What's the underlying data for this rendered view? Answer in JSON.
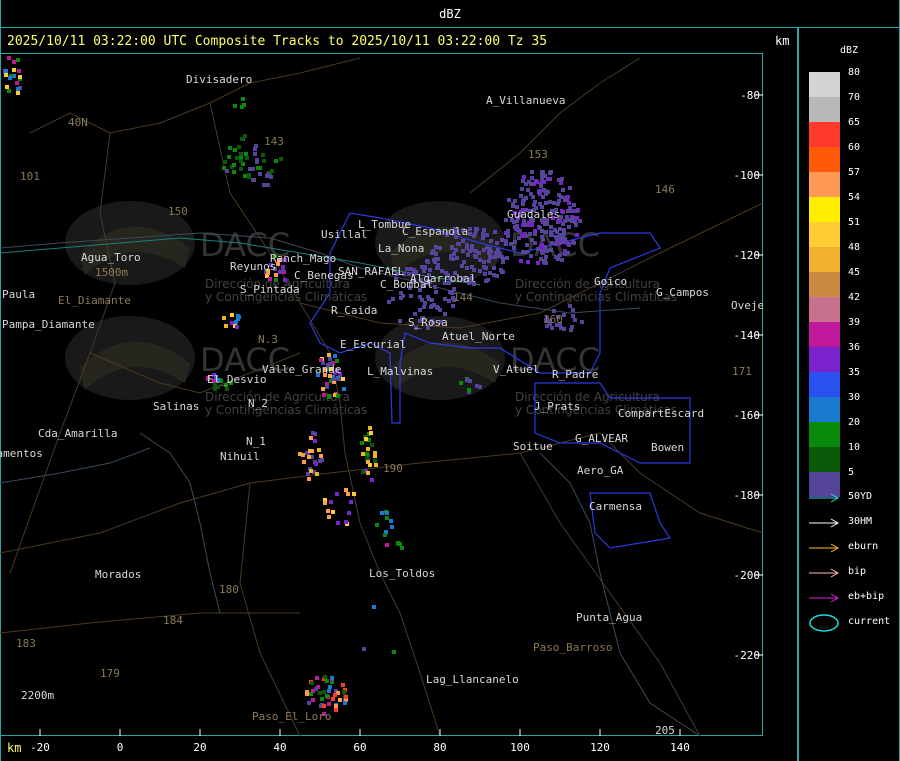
{
  "title": "dBZ",
  "header": "2025/10/11 03:22:00 UTC Composite Tracks to 2025/10/11 03:22:00 Tz 35",
  "km_top": "km",
  "km_bottom": "km",
  "x_ticks": [
    "-20",
    "0",
    "20",
    "40",
    "60",
    "80",
    "100",
    "120",
    "140"
  ],
  "y_ticks": [
    "-80",
    "-100",
    "-120",
    "-140",
    "-160",
    "-180",
    "-200",
    "-220"
  ],
  "legend": {
    "title": "dBZ",
    "levels": [
      {
        "label": "80",
        "color": "#d4d4d4"
      },
      {
        "label": "70",
        "color": "#b8b8b8"
      },
      {
        "label": "65",
        "color": "#ff3a2a"
      },
      {
        "label": "60",
        "color": "#ff5a0a"
      },
      {
        "label": "57",
        "color": "#ff9955"
      },
      {
        "label": "54",
        "color": "#ffee00"
      },
      {
        "label": "51",
        "color": "#ffcc33"
      },
      {
        "label": "48",
        "color": "#f0b030"
      },
      {
        "label": "45",
        "color": "#cc8a40"
      },
      {
        "label": "42",
        "color": "#c87090"
      },
      {
        "label": "39",
        "color": "#c0189a"
      },
      {
        "label": "36",
        "color": "#7a22cc"
      },
      {
        "label": "35",
        "color": "#2a50ee"
      },
      {
        "label": "30",
        "color": "#1a7ad0"
      },
      {
        "label": "20",
        "color": "#0a8a0a"
      },
      {
        "label": "10",
        "color": "#0a5a0a"
      },
      {
        "label": "5",
        "color": "#554499"
      }
    ],
    "tracks": [
      {
        "label": "50YD",
        "color": "#22dddd"
      },
      {
        "label": "30HM",
        "color": "#ffffff"
      },
      {
        "label": "eburn",
        "color": "#ffbb33"
      },
      {
        "label": "bip",
        "color": "#ffbbbb"
      },
      {
        "label": "eb+bip",
        "color": "#dd22dd"
      }
    ],
    "current_label": "current",
    "current_color": "#22dddd"
  },
  "places": [
    {
      "name": "Divisadero"
    },
    {
      "name": "A_Villanueva"
    },
    {
      "name": "40N"
    },
    {
      "name": "101"
    },
    {
      "name": "150"
    },
    {
      "name": "153"
    },
    {
      "name": "146"
    },
    {
      "name": "143"
    },
    {
      "name": "Usillal"
    },
    {
      "name": "L_Tombue"
    },
    {
      "name": "C_Espanola"
    },
    {
      "name": "La_Nona"
    },
    {
      "name": "Guadales"
    },
    {
      "name": "Agua_Toro"
    },
    {
      "name": "1500m"
    },
    {
      "name": "Reyunos"
    },
    {
      "name": "Ranch_Mago"
    },
    {
      "name": "C_Benegas"
    },
    {
      "name": "SAN_RAFAEL"
    },
    {
      "name": "Algarrobal"
    },
    {
      "name": "C_Bombal"
    },
    {
      "name": "Goico"
    },
    {
      "name": "G_Campos"
    },
    {
      "name": "Ovejer"
    },
    {
      "name": "Paula"
    },
    {
      "name": "Pampa_Diamante"
    },
    {
      "name": "S_Pintada"
    },
    {
      "name": "El_Diamante"
    },
    {
      "name": "R_Caida"
    },
    {
      "name": "S_Rosa"
    },
    {
      "name": "Atuel_Norte"
    },
    {
      "name": "E_Escurial"
    },
    {
      "name": "Valle_Grande"
    },
    {
      "name": "L_Malvinas"
    },
    {
      "name": "V_Atuel"
    },
    {
      "name": "R_Padre"
    },
    {
      "name": "El_Desvio"
    },
    {
      "name": "Salinas"
    },
    {
      "name": "N_2"
    },
    {
      "name": "N_1"
    },
    {
      "name": "Nihuil"
    },
    {
      "name": "Cda_Amarilla"
    },
    {
      "name": "Carramentos"
    },
    {
      "name": "J_Prats"
    },
    {
      "name": "CompartEscard"
    },
    {
      "name": "G_ALVEAR"
    },
    {
      "name": "Soitue"
    },
    {
      "name": "Bowen"
    },
    {
      "name": "Aero_GA"
    },
    {
      "name": "Carmensa"
    },
    {
      "name": "Los_Toldos"
    },
    {
      "name": "Morados"
    },
    {
      "name": "180"
    },
    {
      "name": "184"
    },
    {
      "name": "183"
    },
    {
      "name": "179"
    },
    {
      "name": "190"
    },
    {
      "name": "Paso_Barroso"
    },
    {
      "name": "Punta_Agua"
    },
    {
      "name": "Lag_Llancanelo"
    },
    {
      "name": "2200m"
    },
    {
      "name": "Paso_El_Loro"
    },
    {
      "name": "205"
    },
    {
      "name": "171"
    },
    {
      "name": "160"
    },
    {
      "name": "144"
    },
    {
      "name": "N.3"
    }
  ],
  "watermark": {
    "brand": "DACC",
    "subtitle_1": "Dirección de Agricultura",
    "subtitle_2": "y Contingencias Climáticas"
  }
}
